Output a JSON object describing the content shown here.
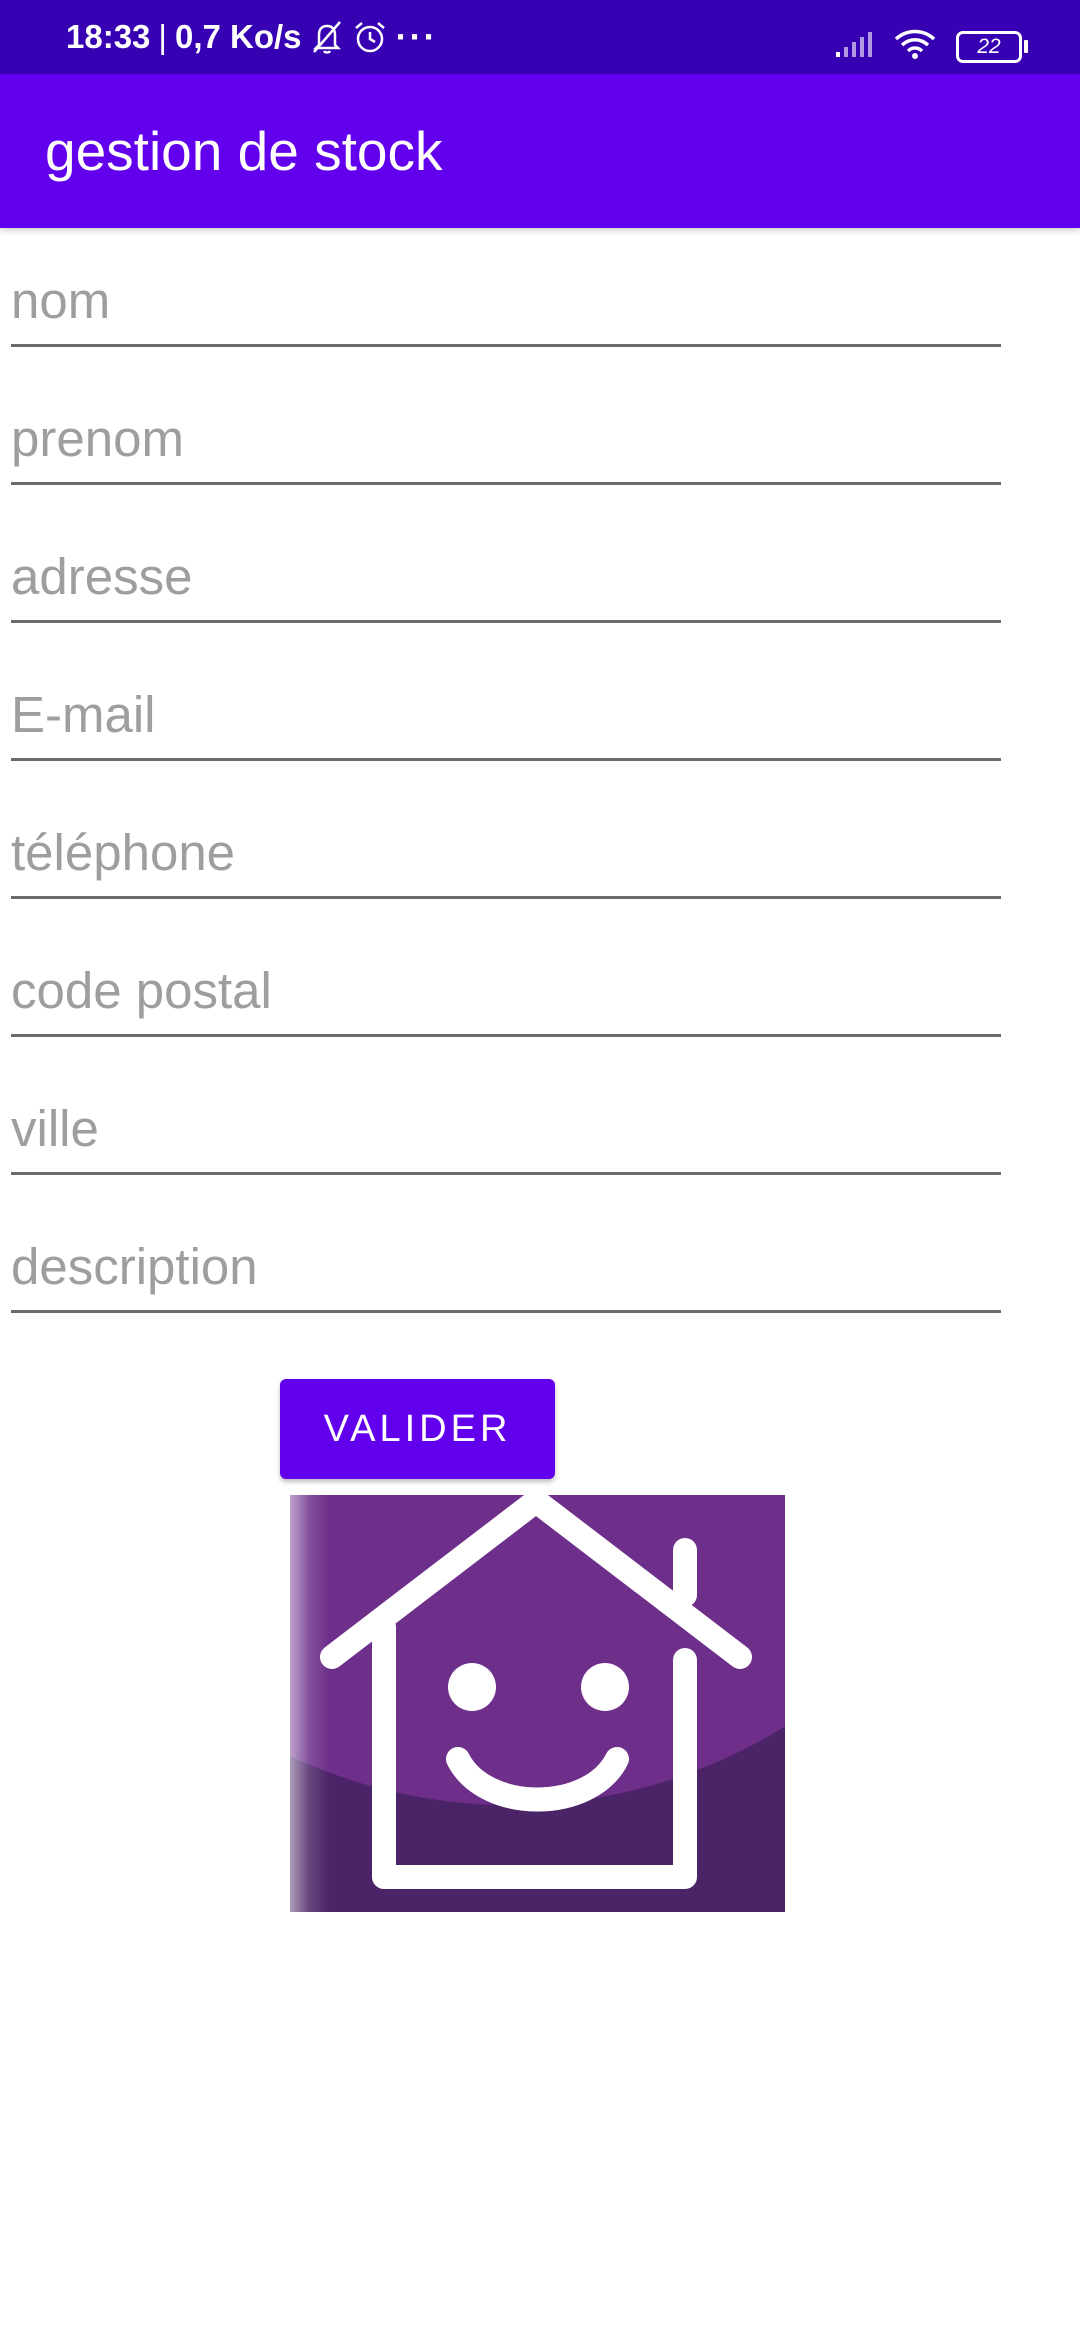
{
  "status_bar": {
    "time": "18:33",
    "separator": "|",
    "speed": "0,7 Ko/s",
    "more": "···",
    "battery": "22",
    "icons": [
      "bell-off-icon",
      "alarm-icon",
      "signal-icon",
      "wifi-icon",
      "battery-icon"
    ]
  },
  "app_bar": {
    "title": "gestion de stock",
    "color": "#6200ee",
    "status_color": "#3700b3"
  },
  "form": {
    "fields": [
      {
        "name": "nom",
        "placeholder": "nom",
        "value": ""
      },
      {
        "name": "prenom",
        "placeholder": "prenom",
        "value": ""
      },
      {
        "name": "adresse",
        "placeholder": "adresse",
        "value": ""
      },
      {
        "name": "email",
        "placeholder": "E-mail",
        "value": ""
      },
      {
        "name": "telephone",
        "placeholder": "téléphone",
        "value": ""
      },
      {
        "name": "code-postal",
        "placeholder": "code postal",
        "value": ""
      },
      {
        "name": "ville",
        "placeholder": "ville",
        "value": ""
      },
      {
        "name": "description",
        "placeholder": "description",
        "value": ""
      }
    ],
    "submit_label": "VALIDER"
  },
  "logo": {
    "icon": "house-smiley-logo",
    "colors": {
      "light": "#6d2f8a",
      "dark": "#4b2467"
    }
  }
}
